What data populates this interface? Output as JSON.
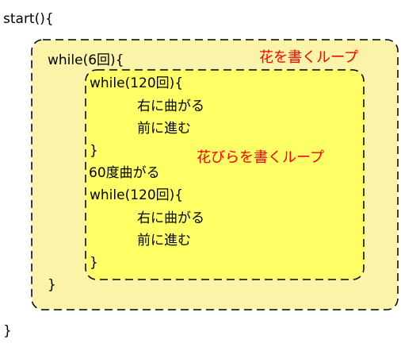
{
  "code": {
    "start_line": "start(){",
    "outer_while": "while(6回){",
    "inner_while_1": "while(120回){",
    "turn_right_1": "右に曲がる",
    "forward_1": "前に進む",
    "inner_close_1": "}",
    "turn_60": "60度曲がる",
    "inner_while_2": "while(120回){",
    "turn_right_2": "右に曲がる",
    "forward_2": "前に進む",
    "inner_close_2": "}",
    "outer_close": "}",
    "end_line": "}"
  },
  "labels": {
    "flower_loop": "花を書くループ",
    "petal_loop": "花びらを書くループ"
  },
  "colors": {
    "outer_fill": "#faf3a8",
    "inner_fill": "#ffff66",
    "label_red": "#ff0000",
    "border": "#000000"
  }
}
